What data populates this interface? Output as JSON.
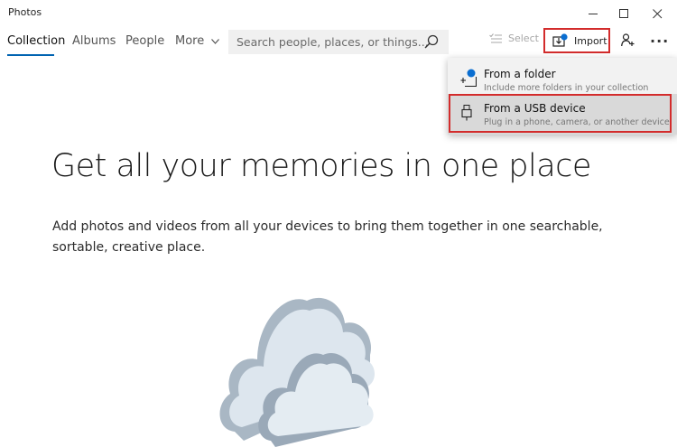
{
  "app": {
    "title": "Photos"
  },
  "window": {
    "minimize_icon": "minimize-icon",
    "maximize_icon": "maximize-icon",
    "close_icon": "close-icon"
  },
  "nav": {
    "tabs": [
      {
        "label": "Collection",
        "active": true
      },
      {
        "label": "Albums",
        "active": false
      },
      {
        "label": "People",
        "active": false
      },
      {
        "label": "More",
        "active": false
      }
    ],
    "accent": "#0063b1"
  },
  "search": {
    "placeholder": "Search people, places, or things..."
  },
  "toolbar": {
    "select_label": "Select",
    "import_label": "Import",
    "more_label": "..."
  },
  "import_menu": {
    "items": [
      {
        "title": "From a folder",
        "subtitle": "Include more folders in your collection",
        "icon": "folder-add-icon"
      },
      {
        "title": "From a USB device",
        "subtitle": "Plug in a phone, camera, or another device",
        "icon": "usb-icon"
      }
    ],
    "highlight_color": "#d32c2c"
  },
  "main": {
    "headline": "Get all your memories in one place",
    "description": "Add photos and videos from all your devices to bring them together in one searchable, sortable, creative place."
  }
}
